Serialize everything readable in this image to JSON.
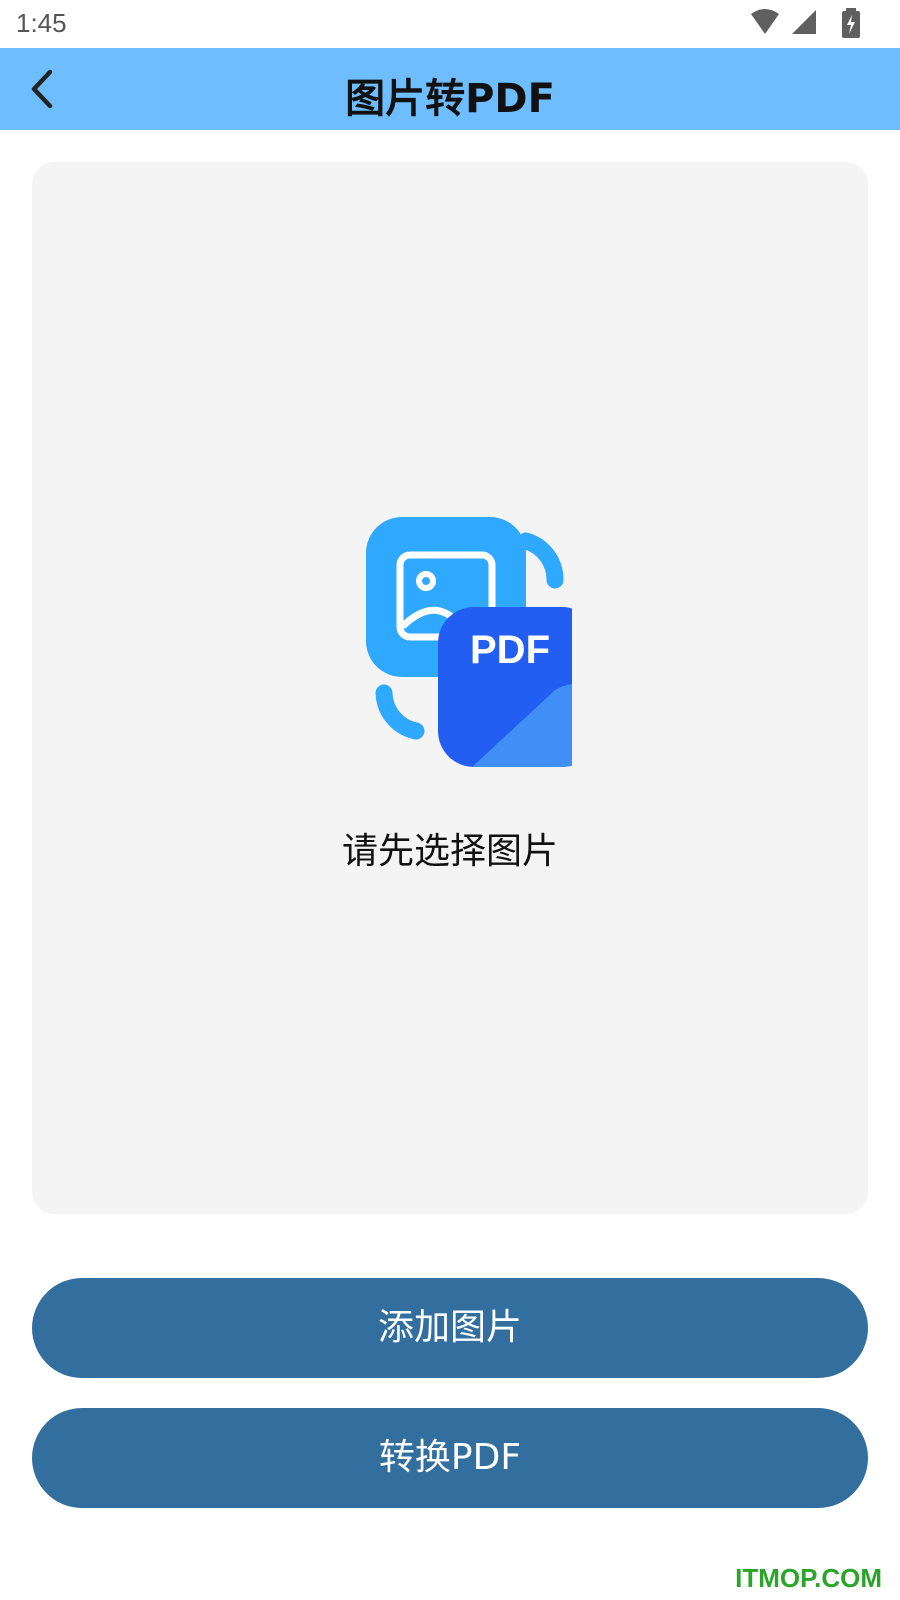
{
  "status_bar": {
    "time": "1:45",
    "icons": [
      "wifi-icon",
      "cell-signal-icon",
      "battery-icon"
    ]
  },
  "app_bar": {
    "title": "图片转PDF",
    "back_icon": "chevron-left-icon"
  },
  "preview": {
    "illustration_icon": "image-to-pdf-icon",
    "badge_text": "PDF",
    "hint": "请先选择图片"
  },
  "buttons": {
    "add_images": "添加图片",
    "convert_pdf": "转换PDF"
  },
  "watermark": "ITMOP.COM",
  "colors": {
    "app_bar": "#6ebdff",
    "button": "#336f9e",
    "panel": "#f4f4f4",
    "icon_light_blue": "#2fa8ff",
    "icon_dark_blue": "#235ef2",
    "watermark": "#2aa52a"
  }
}
